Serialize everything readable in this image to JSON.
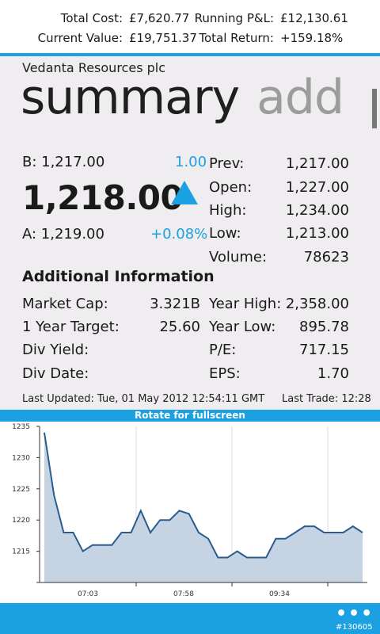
{
  "portfolio": {
    "total_cost_label": "Total Cost:",
    "total_cost_value": "£7,620.77",
    "running_pl_label": "Running P&L:",
    "running_pl_value": "£12,130.61",
    "current_value_label": "Current Value:",
    "current_value_value": "£19,751.37",
    "total_return_label": "Total Return:",
    "total_return_value": "+159.18%"
  },
  "company_name": "Vedanta Resources plc",
  "pivot": {
    "active": "summary",
    "inactive": "add"
  },
  "quote": {
    "bid": "B: 1,217.00",
    "ask": "A: 1,219.00",
    "price": "1,218.00",
    "change": "1.00",
    "change_pct": "+0.08%",
    "direction": "up-arrow-icon",
    "stats": [
      {
        "label": "Prev:",
        "value": "1,217.00"
      },
      {
        "label": "Open:",
        "value": "1,227.00"
      },
      {
        "label": "High:",
        "value": "1,234.00"
      },
      {
        "label": "Low:",
        "value": "1,213.00"
      },
      {
        "label": "Volume:",
        "value": "78623"
      }
    ]
  },
  "additional": {
    "title": "Additional Information",
    "left": [
      {
        "label": "Market Cap:",
        "value": "3.321B"
      },
      {
        "label": "1 Year Target:",
        "value": "25.60"
      },
      {
        "label": "Div Yield:",
        "value": ""
      },
      {
        "label": "Div Date:",
        "value": ""
      }
    ],
    "right": [
      {
        "label": "Year High:",
        "value": "2,358.00"
      },
      {
        "label": "Year Low:",
        "value": "895.78"
      },
      {
        "label": "P/E:",
        "value": "717.15"
      },
      {
        "label": "EPS:",
        "value": "1.70"
      }
    ]
  },
  "last_updated": "Last Updated: Tue, 01 May 2012 12:54:11 GMT",
  "last_trade": "Last Trade: 12:28",
  "rotate_hint": "Rotate for fullscreen",
  "more_label": "•••",
  "watermark": "#130605",
  "colors": {
    "accent": "#1ba1e2",
    "panel": "#efedef",
    "chart_fill": "#c5d3e2",
    "chart_line": "#2a5d8f"
  },
  "chart_data": {
    "type": "area",
    "x_tick_labels": [
      "07:03",
      "07:58",
      "09:34"
    ],
    "y_ticks": [
      1215,
      1220,
      1225,
      1230,
      1235
    ],
    "ylim": [
      1210,
      1235
    ],
    "grid": "vertical",
    "series": [
      {
        "values": [
          1234,
          1224,
          1218,
          1218,
          1215,
          1216,
          1216,
          1216,
          1218,
          1218,
          1221.5,
          1218,
          1220,
          1220,
          1221.5,
          1221,
          1218,
          1217,
          1214,
          1214,
          1215,
          1214,
          1214,
          1214,
          1217,
          1217,
          1218,
          1219,
          1219,
          1218,
          1218,
          1218,
          1219,
          1218
        ]
      }
    ]
  }
}
